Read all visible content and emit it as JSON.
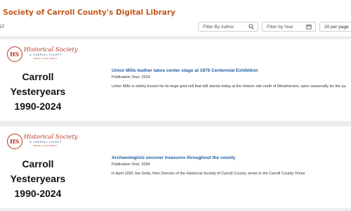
{
  "header": {
    "title": "l Society of Carroll County's Digital Library"
  },
  "toolbar": {
    "result_count": "57",
    "filter_author_placeholder": "Filter By Author",
    "filter_year_placeholder": "Filter by Year",
    "per_page": "20 per page"
  },
  "results": [
    {
      "logo": {
        "mark": "HS",
        "name": "Historical Society",
        "subtitle": "of CARROLL COUNTY",
        "tagline": "Explore • Learn • Belong"
      },
      "thumb_title_lines": [
        "Carroll",
        "Yesteryears",
        "1990-2024"
      ],
      "title": "Union Mills leather takes center stage at 1876 Centennial Exhibition",
      "pub_year": "Publication Year: 2024",
      "excerpt": "Union Mills is widely known for its large grist mill that still stands today at the historic site north of Westminster, open seasonally for the pu"
    },
    {
      "logo": {
        "mark": "HS",
        "name": "Historical Society",
        "subtitle": "of CARROLL COUNTY",
        "tagline": "Explore • Learn • Belong"
      },
      "thumb_title_lines": [
        "Carroll",
        "Yesteryears",
        "1990-2024"
      ],
      "title": "Archaeologists uncover treasures throughout the county",
      "pub_year": "Publication Year: 2024",
      "excerpt": "In April 1993 Joe Getty, then Director of the Historical Society of Carroll County, wrote in the Carroll County Times"
    }
  ],
  "colors": {
    "brand_orange": "#c4581e",
    "logo_red": "#b8351d",
    "link_blue": "#1d5e9e"
  },
  "icons": {
    "author_filter": "search-icon",
    "year_filter": "calendar-icon"
  }
}
